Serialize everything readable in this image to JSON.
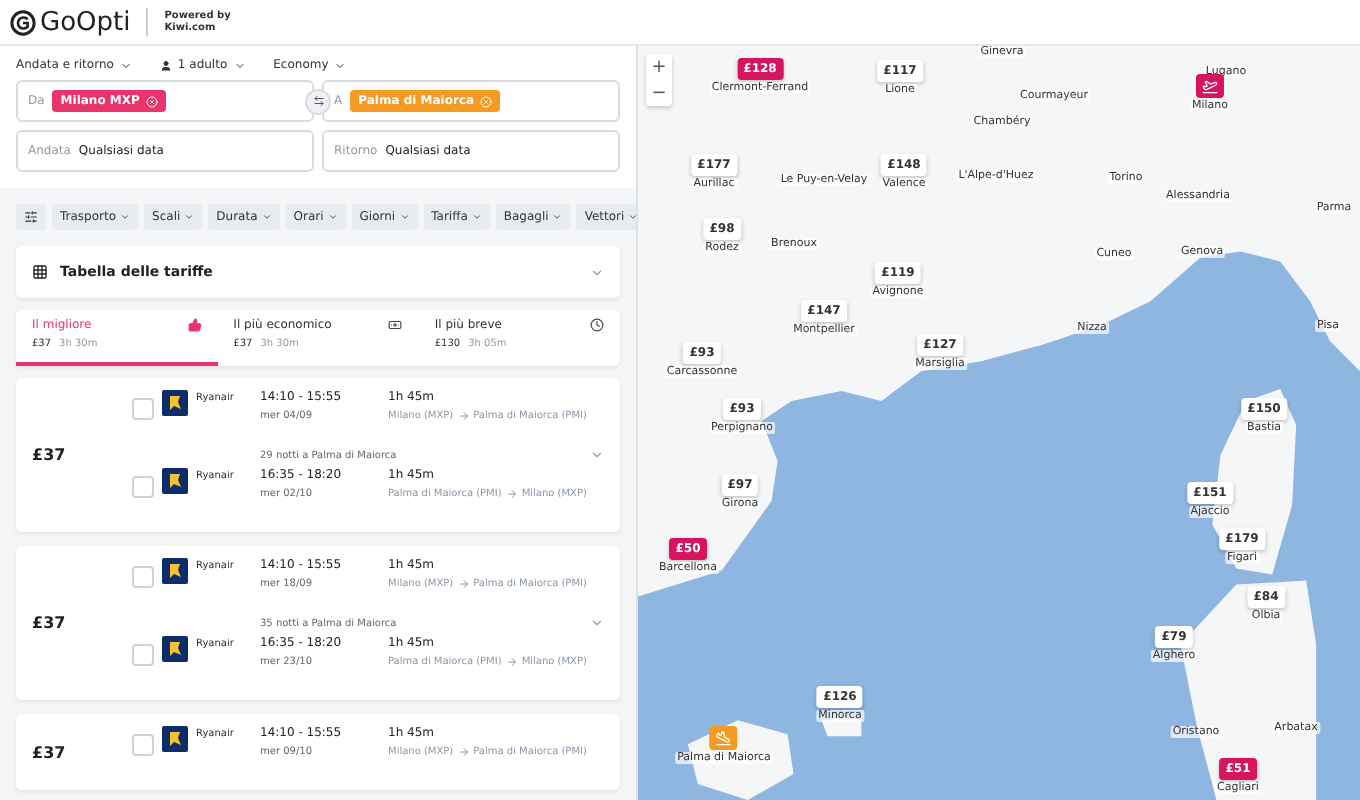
{
  "header": {
    "logo": "GoOpti",
    "powered_by": [
      "Powered by",
      "Kiwi.com"
    ]
  },
  "search": {
    "trip_type": "Andata e ritorno",
    "passengers": "1 adulto",
    "cabin": "Economy",
    "from": {
      "label": "Da",
      "value": "Milano MXP"
    },
    "to": {
      "label": "A",
      "value": "Palma di Maiorca"
    },
    "depart": {
      "label": "Andata",
      "value": "Qualsiasi data"
    },
    "return": {
      "label": "Ritorno",
      "value": "Qualsiasi data"
    }
  },
  "filters": [
    "Trasporto",
    "Scali",
    "Durata",
    "Orari",
    "Giorni",
    "Tariffa",
    "Bagagli",
    "Vettori"
  ],
  "fare_table": {
    "title": "Tabella delle tariffe",
    "expanded": false
  },
  "sort_tabs": [
    {
      "kind": "best",
      "label": "Il migliore",
      "price": "£37",
      "duration": "3h 30m",
      "selected": true
    },
    {
      "kind": "cheapest",
      "label": "Il più economico",
      "price": "£37",
      "duration": "3h 30m",
      "selected": false
    },
    {
      "kind": "fastest",
      "label": "Il più breve",
      "price": "£130",
      "duration": "3h 05m",
      "selected": false
    }
  ],
  "results": [
    {
      "price": "£37",
      "stay": "29 notti a Palma di Maiorca",
      "legs": [
        {
          "airline": "Ryanair",
          "times": "14:10 - 15:55",
          "date": "mer 04/09",
          "duration": "1h 45m",
          "from": "Milano (MXP)",
          "to": "Palma di Maiorca (PMI)",
          "checked": false
        },
        {
          "airline": "Ryanair",
          "times": "16:35 - 18:20",
          "date": "mer 02/10",
          "duration": "1h 45m",
          "from": "Palma di Maiorca (PMI)",
          "to": "Milano (MXP)",
          "checked": false
        }
      ]
    },
    {
      "price": "£37",
      "stay": "35 notti a Palma di Maiorca",
      "legs": [
        {
          "airline": "Ryanair",
          "times": "14:10 - 15:55",
          "date": "mer 18/09",
          "duration": "1h 45m",
          "from": "Milano (MXP)",
          "to": "Palma di Maiorca (PMI)",
          "checked": false
        },
        {
          "airline": "Ryanair",
          "times": "16:35 - 18:20",
          "date": "mer 23/10",
          "duration": "1h 45m",
          "from": "Palma di Maiorca (PMI)",
          "to": "Milano (MXP)",
          "checked": false
        }
      ]
    },
    {
      "price": "£37",
      "legs": [
        {
          "airline": "Ryanair",
          "times": "14:10 - 15:55",
          "date": "mer 09/10",
          "duration": "1h 45m",
          "from": "Milano (MXP)",
          "to": "Palma di Maiorca (PMI)",
          "checked": false
        }
      ]
    }
  ],
  "map": {
    "zoom_in": "+",
    "zoom_out": "−",
    "markers": [
      {
        "kind": "price",
        "price": "£128",
        "city": "Clermont-Ferrand",
        "highlight": true
      },
      {
        "kind": "price",
        "price": "£117",
        "city": "Lione",
        "highlight": false
      },
      {
        "kind": "origin",
        "city": "Milano"
      },
      {
        "kind": "price",
        "price": "£177",
        "city": "Aurillac",
        "highlight": false
      },
      {
        "kind": "price",
        "price": "£148",
        "city": "Valence",
        "highlight": false
      },
      {
        "kind": "price",
        "price": "£98",
        "city": "Rodez",
        "highlight": false
      },
      {
        "kind": "price",
        "price": "£119",
        "city": "Avignone",
        "highlight": false
      },
      {
        "kind": "price",
        "price": "£147",
        "city": "Montpellier",
        "highlight": false
      },
      {
        "kind": "price",
        "price": "£127",
        "city": "Marsiglia",
        "highlight": false
      },
      {
        "kind": "price",
        "price": "£93",
        "city": "Carcassonne",
        "highlight": false
      },
      {
        "kind": "price",
        "price": "£93",
        "city": "Perpignano",
        "highlight": false
      },
      {
        "kind": "price",
        "price": "£97",
        "city": "Girona",
        "highlight": false
      },
      {
        "kind": "price",
        "price": "£50",
        "city": "Barcellona",
        "highlight": true
      },
      {
        "kind": "price",
        "price": "£126",
        "city": "Minorca",
        "highlight": false
      },
      {
        "kind": "destination",
        "city": "Palma di Maiorca"
      },
      {
        "kind": "price",
        "price": "£150",
        "city": "Bastia",
        "highlight": false
      },
      {
        "kind": "price",
        "price": "£151",
        "city": "Ajaccio",
        "highlight": false
      },
      {
        "kind": "price",
        "price": "£179",
        "city": "Figari",
        "highlight": false
      },
      {
        "kind": "price",
        "price": "£84",
        "city": "Olbia",
        "highlight": false
      },
      {
        "kind": "price",
        "price": "£79",
        "city": "Alghero",
        "highlight": false
      },
      {
        "kind": "price",
        "price": "£51",
        "city": "Cagliari",
        "highlight": true
      }
    ],
    "cities": [
      "Ginevra",
      "Lugano",
      "Courmayeur",
      "Chambéry",
      "Le Puy-en-Velay",
      "L'Alpe-d'Huez",
      "Torino",
      "Alessandria",
      "Parma",
      "Brenoux",
      "Cuneo",
      "Genova",
      "Nizza",
      "Pisa",
      "Oristano",
      "Arbatax"
    ]
  }
}
